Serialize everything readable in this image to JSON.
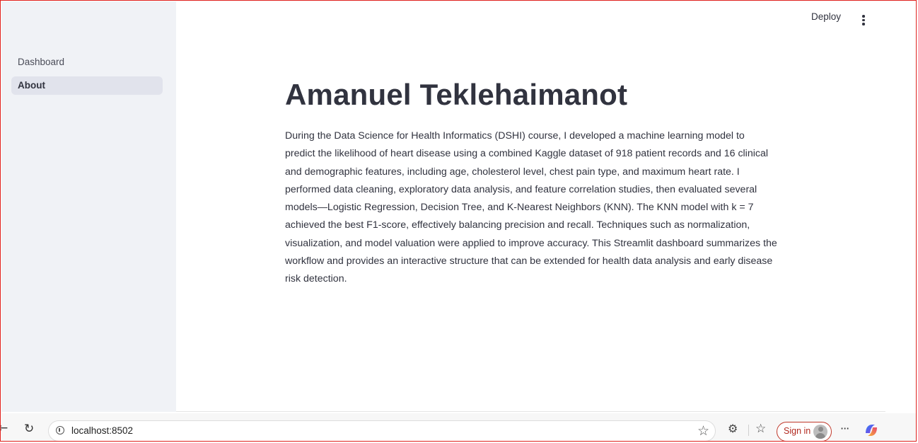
{
  "sidebar": {
    "items": [
      {
        "label": "Dashboard",
        "active": false
      },
      {
        "label": "About",
        "active": true
      }
    ]
  },
  "header": {
    "deploy_label": "Deploy",
    "menu_icon": "kebab-menu-icon"
  },
  "main": {
    "title": "Amanuel Teklehaimanot",
    "body": "During the Data Science for Health Informatics (DSHI) course, I developed a machine learning model to predict the likelihood of heart disease using a combined Kaggle dataset of 918 patient records and 16 clinical and demographic features, including age, cholesterol level, chest pain type, and maximum heart rate. I performed data cleaning, exploratory data analysis, and feature correlation studies, then evaluated several models—Logistic Regression, Decision Tree, and K-Nearest Neighbors (KNN). The KNN model with k = 7 achieved the best F1-score, effectively balancing precision and recall. Techniques such as normalization, visualization, and model valuation were applied to improve accuracy. This Streamlit dashboard summarizes the workflow and provides an interactive structure that can be extended for health data analysis and early disease risk detection."
  },
  "browser": {
    "url": "localhost:8502",
    "signin_label": "Sign in",
    "icons": [
      "back-arrow-icon",
      "reload-icon",
      "info-icon",
      "star-icon",
      "extensions-icon",
      "favorites-icon",
      "avatar-icon",
      "more-icon",
      "copilot-icon"
    ]
  },
  "colors": {
    "sidebar_bg": "#f0f2f6",
    "active_item_bg": "#e1e3ec",
    "text": "#31333f",
    "frame_border": "#e0211d",
    "signin_accent": "#c0392b"
  }
}
